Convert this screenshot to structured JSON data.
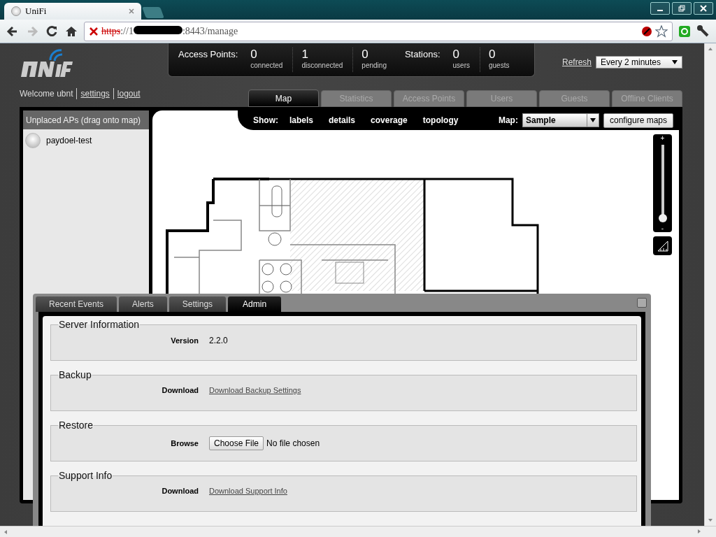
{
  "browser": {
    "tab_title": "UniFi",
    "address": {
      "scheme": "https",
      "host_start": "://1",
      "host_end": ":8443/manage"
    }
  },
  "header": {
    "welcome": "Welcome ubnt",
    "links": [
      "settings",
      "logout"
    ],
    "stats": [
      {
        "label": "Access Points:",
        "items": [
          {
            "value": "0",
            "caption": "connected"
          },
          {
            "value": "1",
            "caption": "disconnected"
          },
          {
            "value": "0",
            "caption": "pending"
          }
        ]
      },
      {
        "label": "Stations:",
        "items": [
          {
            "value": "0",
            "caption": "users"
          },
          {
            "value": "0",
            "caption": "guests"
          }
        ]
      }
    ],
    "refresh": {
      "link": "Refresh",
      "interval": "Every 2 minutes"
    }
  },
  "main_tabs": [
    {
      "label": "Map",
      "selected": true
    },
    {
      "label": "Statistics",
      "selected": false
    },
    {
      "label": "Access Points",
      "selected": false
    },
    {
      "label": "Users",
      "selected": false
    },
    {
      "label": "Guests",
      "selected": false
    },
    {
      "label": "Offline Clients",
      "selected": false
    }
  ],
  "sidebar": {
    "title": "Unplaced APs (drag onto map)",
    "items": [
      {
        "name": "paydoel-test"
      }
    ]
  },
  "map_toolbar": {
    "show_label": "Show:",
    "options": [
      "labels",
      "details",
      "coverage",
      "topology"
    ],
    "map_label": "Map:",
    "map_select": "Sample",
    "button": "configure maps"
  },
  "zoom": {
    "plus": "+",
    "minus": "-",
    "level": 0.05
  },
  "bottom_panel": {
    "tabs": [
      {
        "label": "Recent Events",
        "selected": false
      },
      {
        "label": "Alerts",
        "selected": false
      },
      {
        "label": "Settings",
        "selected": false
      },
      {
        "label": "Admin",
        "selected": true
      }
    ],
    "sections": [
      {
        "title": "Server Information",
        "rows": [
          {
            "label": "Version",
            "kind": "text",
            "value": "2.2.0"
          }
        ]
      },
      {
        "title": "Backup",
        "rows": [
          {
            "label": "Download",
            "kind": "link",
            "value": "Download Backup Settings"
          }
        ]
      },
      {
        "title": "Restore",
        "rows": [
          {
            "label": "Browse",
            "kind": "file",
            "button": "Choose File",
            "value": "No file chosen"
          }
        ]
      },
      {
        "title": "Support Info",
        "rows": [
          {
            "label": "Download",
            "kind": "link",
            "value": "Download Support Info"
          }
        ]
      }
    ]
  }
}
